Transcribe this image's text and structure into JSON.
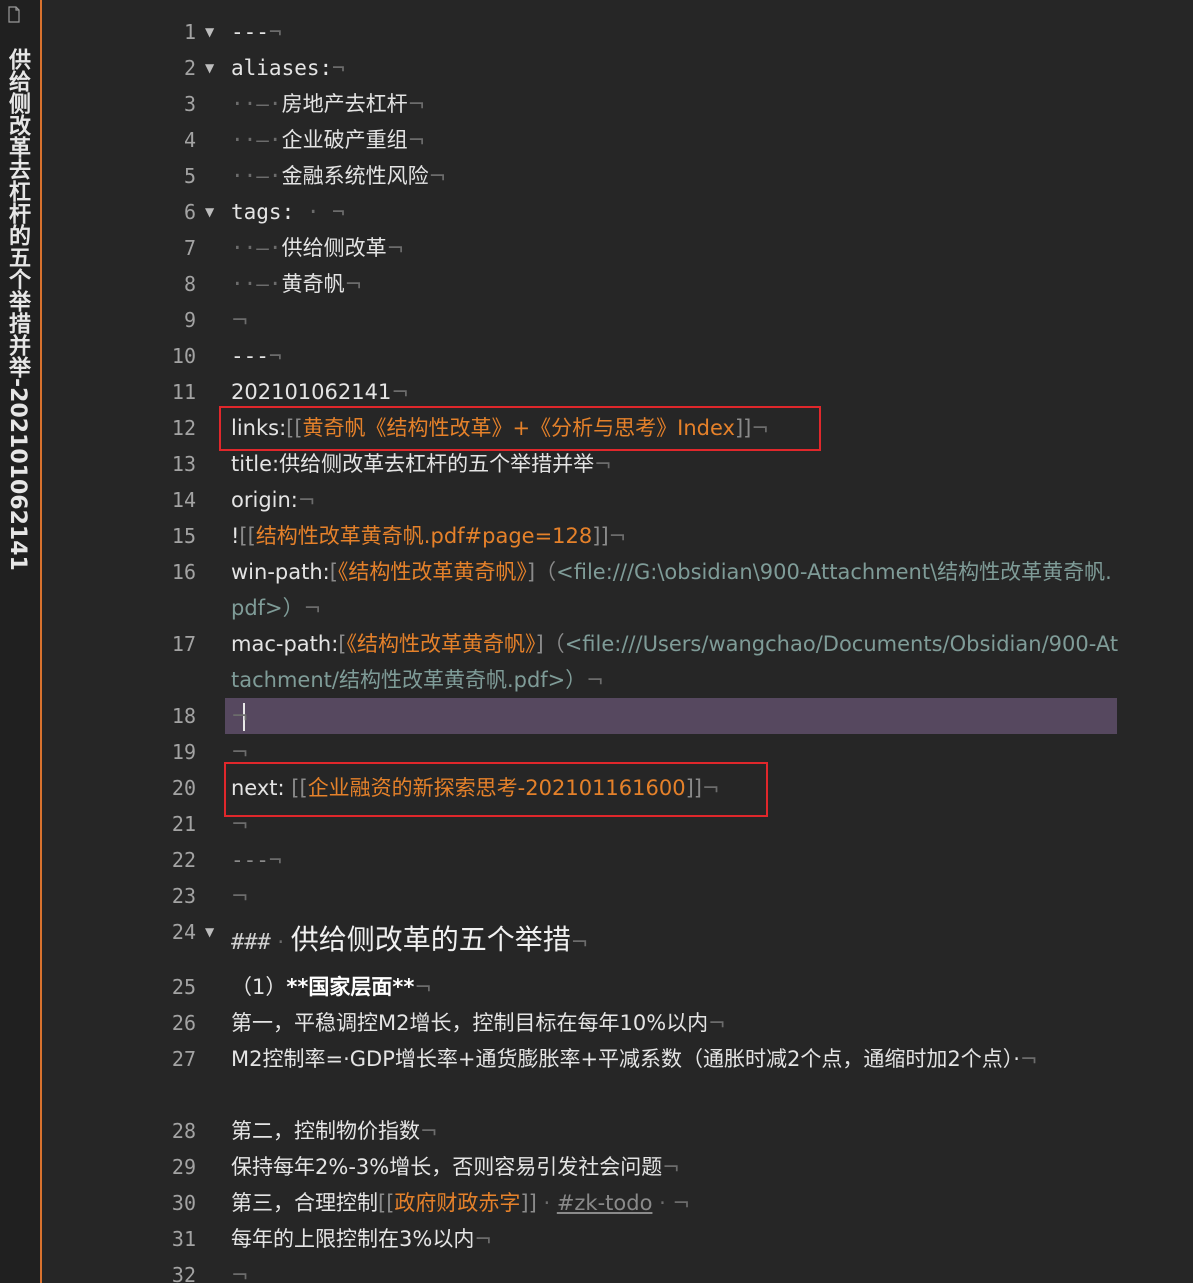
{
  "sidebar": {
    "title": "供给侧改革去杠杆的五个举措并举-202101062141"
  },
  "pilcrow": "¬",
  "editor": {
    "line_numbers": [
      "1",
      "2",
      "3",
      "4",
      "5",
      "6",
      "7",
      "8",
      "9",
      "10",
      "11",
      "12",
      "13",
      "14",
      "15",
      "16",
      "17",
      "18",
      "19",
      "20",
      "21",
      "22",
      "23",
      "24",
      "25",
      "26",
      "27",
      "28",
      "29",
      "30",
      "31",
      "32"
    ],
    "frontmatter": {
      "dashes": "---",
      "aliases_key": "aliases:",
      "aliases": [
        "房地产去杠杆",
        "企业破产重组",
        "金融系统性风险"
      ],
      "tags_key": "tags:",
      "tags": [
        "供给侧改革",
        "黄奇帆"
      ],
      "list_indent": "··–·"
    },
    "id_line": "202101062141",
    "links_key": "links:",
    "links_open": "[[",
    "links_target": "黄奇帆《结构性改革》+《分析与思考》Index",
    "links_close": "]]",
    "title_line": "title:供给侧改革去杠杆的五个举措并举",
    "origin_line": "origin:",
    "embed_bang": "!",
    "embed_target": "结构性改革黄奇帆.pdf#page=128",
    "win_key": "win-path:",
    "win_label": "《结构性改革黄奇帆》",
    "win_url": "<file:///G:\\obsidian\\900-Attachment\\结构性改革黄奇帆.pdf>",
    "mac_key": "mac-path:",
    "mac_label": "《结构性改革黄奇帆》",
    "mac_url": "<file:///Users/wangchao/Documents/Obsidian/900-Attachment/结构性改革黄奇帆.pdf>",
    "next_key": "next:",
    "next_target": "企业融资的新探索思考-202101161600",
    "hr": "---",
    "heading_hashes": "###",
    "heading_text": "供给侧改革的五个举措",
    "l25_prefix": "（1）",
    "l25_bold": "**国家层面**",
    "l26": "第一，平稳调控M2增长，控制目标在每年10%以内",
    "l27": "M2控制率=·GDP增长率+通货膨胀率+平减系数（通胀时减2个点，通缩时加2个点）·",
    "l28": "第二，控制物价指数",
    "l29": "保持每年2%-3%增长，否则容易引发社会问题",
    "l30_prefix": "第三，合理控制",
    "l30_link": "政府财政赤字",
    "l30_tag": "#zk-todo",
    "l31": "每年的上限控制在3%以内"
  }
}
